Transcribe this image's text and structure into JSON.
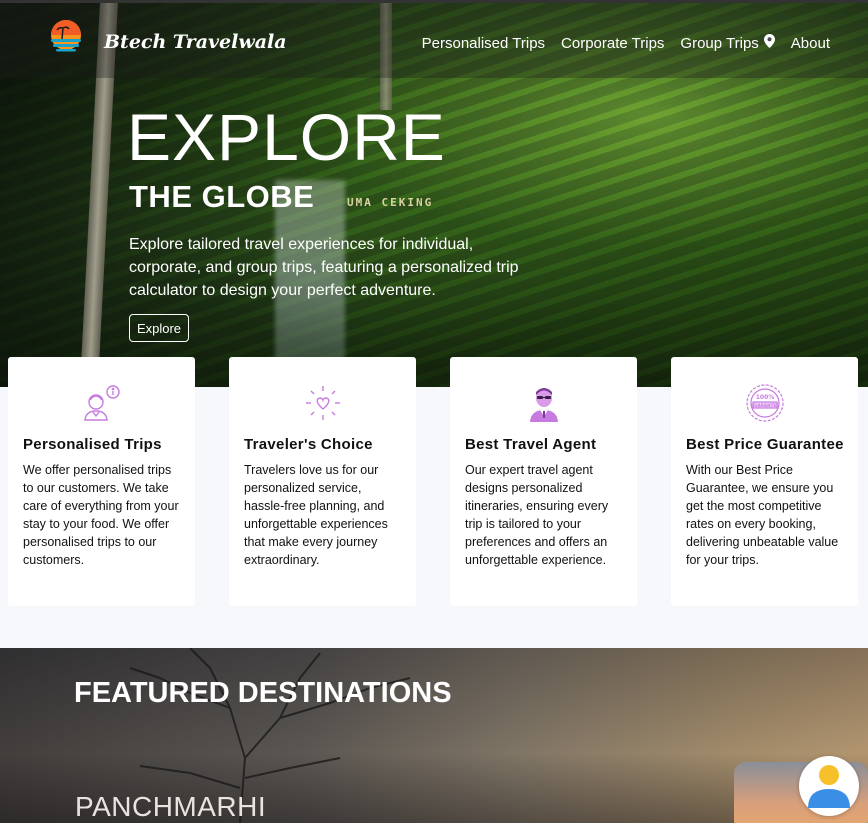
{
  "nav": {
    "brand": "Btech Travelwala",
    "links": [
      {
        "label": "Personalised Trips"
      },
      {
        "label": "Corporate Trips"
      },
      {
        "label": "Group Trips"
      },
      {
        "label": "About"
      }
    ]
  },
  "hero": {
    "title": "EXPLORE",
    "subtitle": "THE GLOBE",
    "description": "Explore tailored travel experiences for individual, corporate, and group trips, featuring a personalized trip calculator to design your perfect adventure.",
    "button_label": "Explore",
    "sign_text": "UMA CEKING"
  },
  "features": [
    {
      "title": "Personalised Trips",
      "icon": "person-info-icon",
      "text": "We offer personalised trips to our customers. We take care of everything from your stay to your food. We offer personalised trips to our customers."
    },
    {
      "title": "Traveler's Choice",
      "icon": "heart-sparkle-icon",
      "text": "Travelers love us for our personalized service, hassle-free planning, and unforgettable experiences that make every journey extraordinary."
    },
    {
      "title": "Best Travel Agent",
      "icon": "agent-icon",
      "text": "Our expert travel agent designs personalized itineraries, ensuring every trip is tailored to your preferences and offers an unforgettable experience."
    },
    {
      "title": "Best Price Guarantee",
      "icon": "guarantee-badge-icon",
      "badge_text": "100% GUARANTEE",
      "text": "With our Best Price Guarantee, we ensure you get the most competitive rates on every booking, delivering unbeatable value for your trips."
    }
  ],
  "featured": {
    "title": "FEATURED DESTINATIONS",
    "destination": "PANCHMARHI"
  },
  "colors": {
    "icon_accent": "#c77be0",
    "card_bg": "#ffffff",
    "section_bg": "#f7f8fc"
  }
}
